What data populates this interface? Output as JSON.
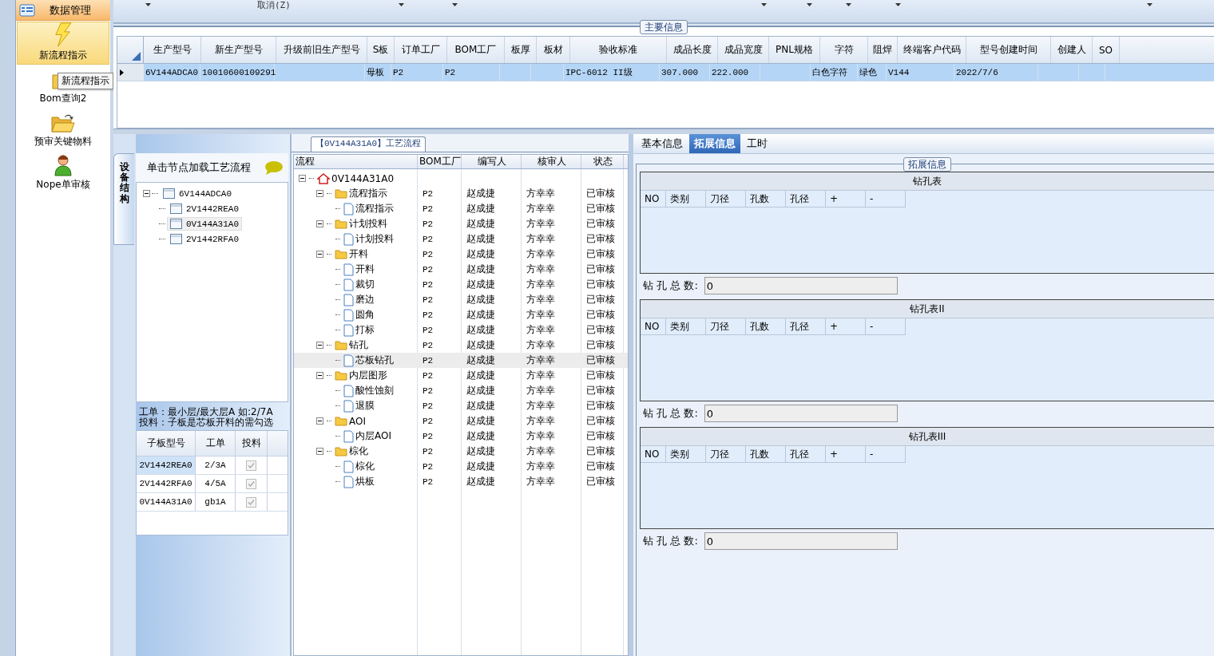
{
  "sidebar": {
    "header": "数据管理",
    "items": [
      {
        "label": "新流程指示",
        "selected": true
      },
      {
        "label": "Bom查询2",
        "selected": false
      },
      {
        "label": "预审关键物料",
        "selected": false
      },
      {
        "label": "Nope单审核",
        "selected": false
      }
    ],
    "tooltip": "新流程指示"
  },
  "toolbar": {
    "button": "取消(Z)"
  },
  "main_info": {
    "title": "主要信息",
    "columns": [
      "生产型号",
      "新生产型号",
      "升级前旧生产型号",
      "S板",
      "订单工厂",
      "BOM工厂",
      "板厚",
      "板材",
      "验收标准",
      "成品长度",
      "成品宽度",
      "PNL规格",
      "字符",
      "阻焊",
      "终端客户代码",
      "型号创建时间",
      "创建人",
      "SO"
    ],
    "rows": [
      {
        "selected": true,
        "cells": [
          "6V144ADCA0",
          "10010600109291",
          null,
          "母板",
          "P2",
          "P2",
          null,
          null,
          "IPC-6012 II级",
          "307.000",
          "222.000",
          null,
          "白色字符",
          "绿色",
          "V144",
          "2022/7/6",
          null,
          null
        ]
      }
    ]
  },
  "structure_panel": {
    "tab": "设备结构",
    "header": "单击节点加载工艺流程",
    "tree": [
      {
        "label": "6V144ADCA0",
        "expanded": true,
        "selected": false,
        "children": [
          {
            "label": "2V1442REA0",
            "selected": false
          },
          {
            "label": "0V144A31A0",
            "selected": true
          },
          {
            "label": "2V1442RFA0",
            "selected": false
          }
        ]
      }
    ],
    "hint_lines": [
      "工单：最小层/最大层A 如:2/7A",
      "投料：子板是芯板开料的需勾选"
    ],
    "table": {
      "columns": [
        "子板型号",
        "工单",
        "投料"
      ],
      "rows": [
        {
          "cells": [
            "2V1442REA0",
            "2/3A"
          ],
          "checked": true,
          "selected": true
        },
        {
          "cells": [
            "2V1442RFA0",
            "4/5A"
          ],
          "checked": true,
          "selected": false
        },
        {
          "cells": [
            "0V144A31A0",
            "gb1A"
          ],
          "checked": true,
          "selected": false
        }
      ]
    }
  },
  "process_flow": {
    "title": "【0V144A31A0】工艺流程",
    "columns": [
      "流程",
      "BOM工厂",
      "编写人",
      "核审人",
      "状态"
    ],
    "tree": [
      {
        "label": "0V144A31A0",
        "kind": "home",
        "expanded": true,
        "selected": false,
        "children": [
          {
            "label": "流程指示",
            "kind": "folder",
            "bom": "P2",
            "author": "赵成捷",
            "reviewer": "方幸幸",
            "status": "已审核",
            "expanded": true,
            "selected": false,
            "children": [
              {
                "label": "流程指示",
                "kind": "file",
                "bom": "P2",
                "author": "赵成捷",
                "reviewer": "方幸幸",
                "status": "已审核",
                "selected": false
              }
            ]
          },
          {
            "label": "计划投料",
            "kind": "folder",
            "bom": "P2",
            "author": "赵成捷",
            "reviewer": "方幸幸",
            "status": "已审核",
            "expanded": true,
            "selected": false,
            "children": [
              {
                "label": "计划投料",
                "kind": "file",
                "bom": "P2",
                "author": "赵成捷",
                "reviewer": "方幸幸",
                "status": "已审核",
                "selected": false
              }
            ]
          },
          {
            "label": "开料",
            "kind": "folder",
            "bom": "P2",
            "author": "赵成捷",
            "reviewer": "方幸幸",
            "status": "已审核",
            "expanded": true,
            "selected": false,
            "children": [
              {
                "label": "开料",
                "kind": "file",
                "bom": "P2",
                "author": "赵成捷",
                "reviewer": "方幸幸",
                "status": "已审核",
                "selected": false
              },
              {
                "label": "裁切",
                "kind": "file",
                "bom": "P2",
                "author": "赵成捷",
                "reviewer": "方幸幸",
                "status": "已审核",
                "selected": false
              },
              {
                "label": "磨边",
                "kind": "file",
                "bom": "P2",
                "author": "赵成捷",
                "reviewer": "方幸幸",
                "status": "已审核",
                "selected": false
              },
              {
                "label": "圆角",
                "kind": "file",
                "bom": "P2",
                "author": "赵成捷",
                "reviewer": "方幸幸",
                "status": "已审核",
                "selected": false
              },
              {
                "label": "打标",
                "kind": "file",
                "bom": "P2",
                "author": "赵成捷",
                "reviewer": "方幸幸",
                "status": "已审核",
                "selected": false
              }
            ]
          },
          {
            "label": "钻孔",
            "kind": "folder",
            "bom": "P2",
            "author": "赵成捷",
            "reviewer": "方幸幸",
            "status": "已审核",
            "expanded": true,
            "selected": false,
            "children": [
              {
                "label": "芯板钻孔",
                "kind": "file",
                "bom": "P2",
                "author": "赵成捷",
                "reviewer": "方幸幸",
                "status": "已审核",
                "selected": true
              }
            ]
          },
          {
            "label": "内层图形",
            "kind": "folder",
            "bom": "P2",
            "author": "赵成捷",
            "reviewer": "方幸幸",
            "status": "已审核",
            "expanded": true,
            "selected": false,
            "children": [
              {
                "label": "酸性蚀刻",
                "kind": "file",
                "bom": "P2",
                "author": "赵成捷",
                "reviewer": "方幸幸",
                "status": "已审核",
                "selected": false
              },
              {
                "label": "退膜",
                "kind": "file",
                "bom": "P2",
                "author": "赵成捷",
                "reviewer": "方幸幸",
                "status": "已审核",
                "selected": false
              }
            ]
          },
          {
            "label": "AOI",
            "kind": "folder",
            "bom": "P2",
            "author": "赵成捷",
            "reviewer": "方幸幸",
            "status": "已审核",
            "expanded": true,
            "selected": false,
            "children": [
              {
                "label": "内层AOI",
                "kind": "file",
                "bom": "P2",
                "author": "赵成捷",
                "reviewer": "方幸幸",
                "status": "已审核",
                "selected": false
              }
            ]
          },
          {
            "label": "棕化",
            "kind": "folder",
            "bom": "P2",
            "author": "赵成捷",
            "reviewer": "方幸幸",
            "status": "已审核",
            "expanded": true,
            "selected": false,
            "children": [
              {
                "label": "棕化",
                "kind": "file",
                "bom": "P2",
                "author": "赵成捷",
                "reviewer": "方幸幸",
                "status": "已审核",
                "selected": false
              },
              {
                "label": "烘板",
                "kind": "file",
                "bom": "P2",
                "author": "赵成捷",
                "reviewer": "方幸幸",
                "status": "已审核",
                "selected": false
              }
            ]
          }
        ]
      }
    ]
  },
  "detail": {
    "tabs": [
      {
        "label": "基本信息",
        "selected": false
      },
      {
        "label": "拓展信息",
        "selected": true
      },
      {
        "label": "工时",
        "selected": false
      }
    ],
    "title": "拓展信息",
    "tables": [
      {
        "title": "钻孔表",
        "columns": [
          "NO",
          "类别",
          "刀径",
          "孔数",
          "孔径",
          "+",
          "-"
        ],
        "total_label": "钻 孔 总 数:",
        "total_value": "0"
      },
      {
        "title": "钻孔表II",
        "columns": [
          "NO",
          "类别",
          "刀径",
          "孔数",
          "孔径",
          "+",
          "-"
        ],
        "total_label": "钻 孔 总 数:",
        "total_value": "0"
      },
      {
        "title": "钻孔表III",
        "columns": [
          "NO",
          "类别",
          "刀径",
          "孔数",
          "孔径",
          "+",
          "-"
        ],
        "total_label": "钻 孔 总 数:",
        "total_value": "0"
      }
    ]
  }
}
